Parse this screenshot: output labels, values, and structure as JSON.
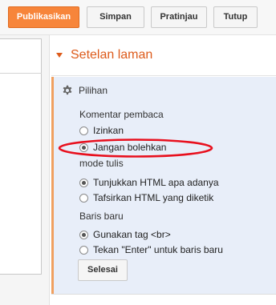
{
  "toolbar": {
    "publish_label": "Publikasikan",
    "save_label": "Simpan",
    "preview_label": "Pratinjau",
    "close_label": "Tutup"
  },
  "settings": {
    "title": "Setelan laman",
    "panel_title": "Pilihan",
    "comments": {
      "label": "Komentar pembaca",
      "options": [
        "Izinkan",
        "Jangan bolehkan"
      ],
      "selected": "Jangan bolehkan"
    },
    "compose_mode": {
      "label": "mode tulis",
      "options": [
        "Tunjukkan HTML apa adanya",
        "Tafsirkan HTML yang diketik"
      ],
      "selected": "Tunjukkan HTML apa adanya"
    },
    "line_breaks": {
      "label": "Baris baru",
      "options": [
        "Gunakan tag <br>",
        "Tekan \"Enter\" untuk baris baru"
      ],
      "selected": "Gunakan tag <br>"
    },
    "done_label": "Selesai"
  },
  "colors": {
    "accent": "#dd5b1b",
    "publish_button": "#f7853a",
    "panel_bg": "#e8eef9",
    "annotation": "#e8101e"
  },
  "icons": {
    "panel": "gear-icon",
    "section_toggle": "triangle-down-icon"
  }
}
